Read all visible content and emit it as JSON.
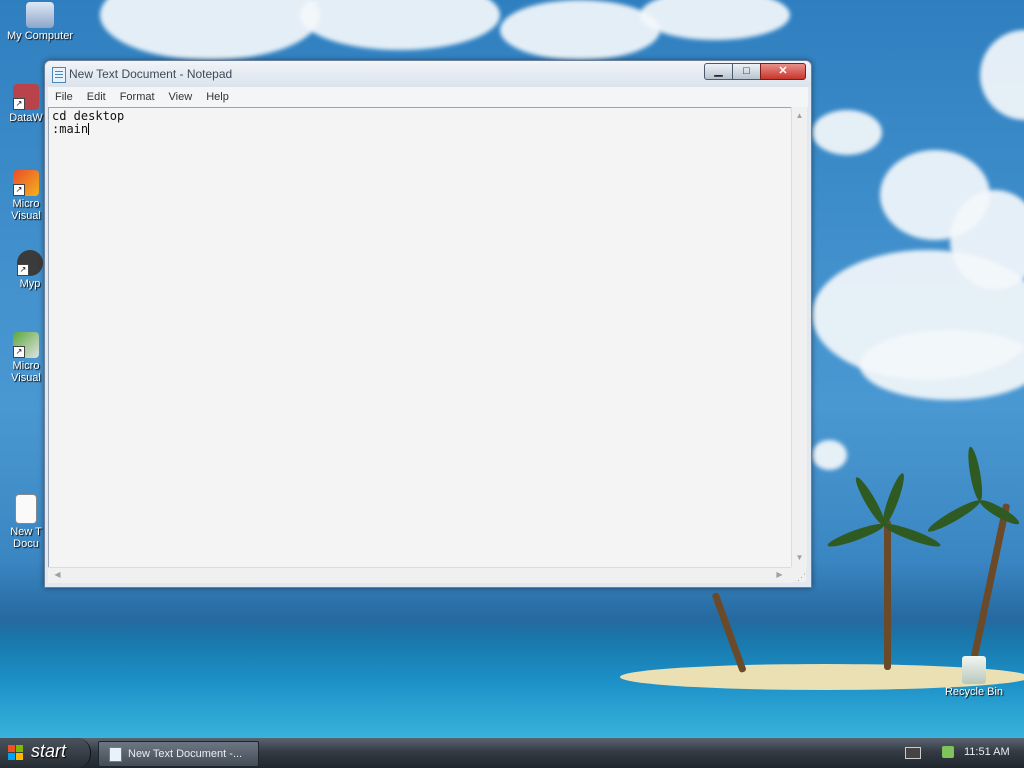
{
  "desktop": {
    "icons": [
      {
        "label": "My Computer",
        "glyph": "computer-icon"
      },
      {
        "label": "DataW",
        "glyph": "app-icon"
      },
      {
        "label": "Micro Visual",
        "glyph": "app-icon"
      },
      {
        "label": "Myp",
        "glyph": "app-icon"
      },
      {
        "label": "Micro Visual",
        "glyph": "app-icon"
      },
      {
        "label": "New T Docu",
        "glyph": "text-document-icon"
      },
      {
        "label": "Recycle Bin",
        "glyph": "recycle-bin-icon"
      }
    ]
  },
  "window": {
    "title": "New Text Document - Notepad",
    "controls": {
      "minimize": "▁",
      "maximize": "□",
      "close": "✕"
    },
    "menu": [
      "File",
      "Edit",
      "Format",
      "View",
      "Help"
    ],
    "content_lines": [
      "cd desktop",
      ":main"
    ]
  },
  "taskbar": {
    "start_label": "start",
    "task_label": "New Text Document -...",
    "clock": "11:51 AM"
  },
  "colors": {
    "sky": "#3f8ecb",
    "close_button": "#c8352b",
    "taskbar": "#343b44"
  }
}
